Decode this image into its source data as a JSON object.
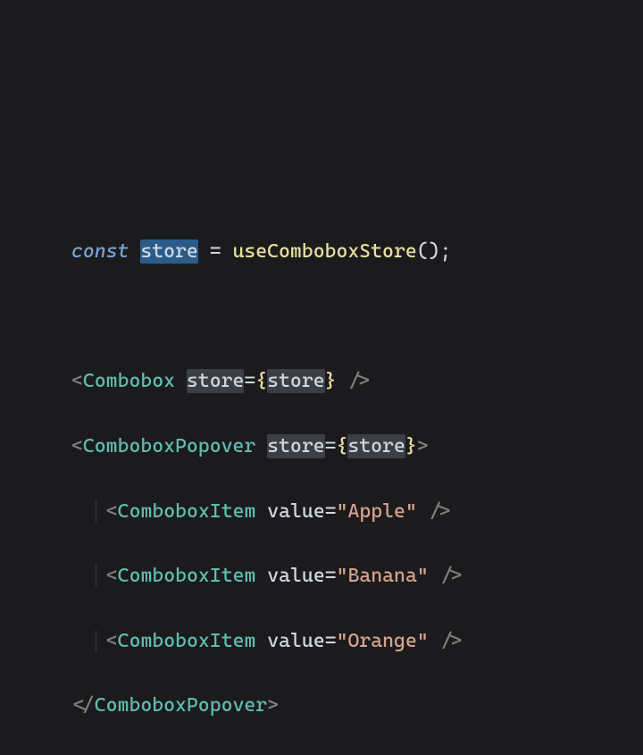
{
  "code": {
    "line1": {
      "kw_const": "const",
      "var_store": "store",
      "op_eq": " = ",
      "fn_call": "useComboboxStore",
      "parens": "();"
    },
    "line3": {
      "open": "<",
      "tag": "Combobox",
      "attr": "store",
      "eq": "=",
      "brace_open": "{",
      "expr": "store",
      "brace_close": "}",
      "close": " />"
    },
    "line4": {
      "open": "<",
      "tag": "ComboboxPopover",
      "attr": "store",
      "eq": "=",
      "brace_open": "{",
      "expr": "store",
      "brace_close": "}",
      "close": ">"
    },
    "items": [
      {
        "tag": "ComboboxItem",
        "attr": "value",
        "eq": "=",
        "str": "\"Apple\""
      },
      {
        "tag": "ComboboxItem",
        "attr": "value",
        "eq": "=",
        "str": "\"Banana\""
      },
      {
        "tag": "ComboboxItem",
        "attr": "value",
        "eq": "=",
        "str": "\"Orange\""
      }
    ],
    "close_popover": {
      "open": "</",
      "tag": "ComboboxPopover",
      "close": ">"
    }
  }
}
